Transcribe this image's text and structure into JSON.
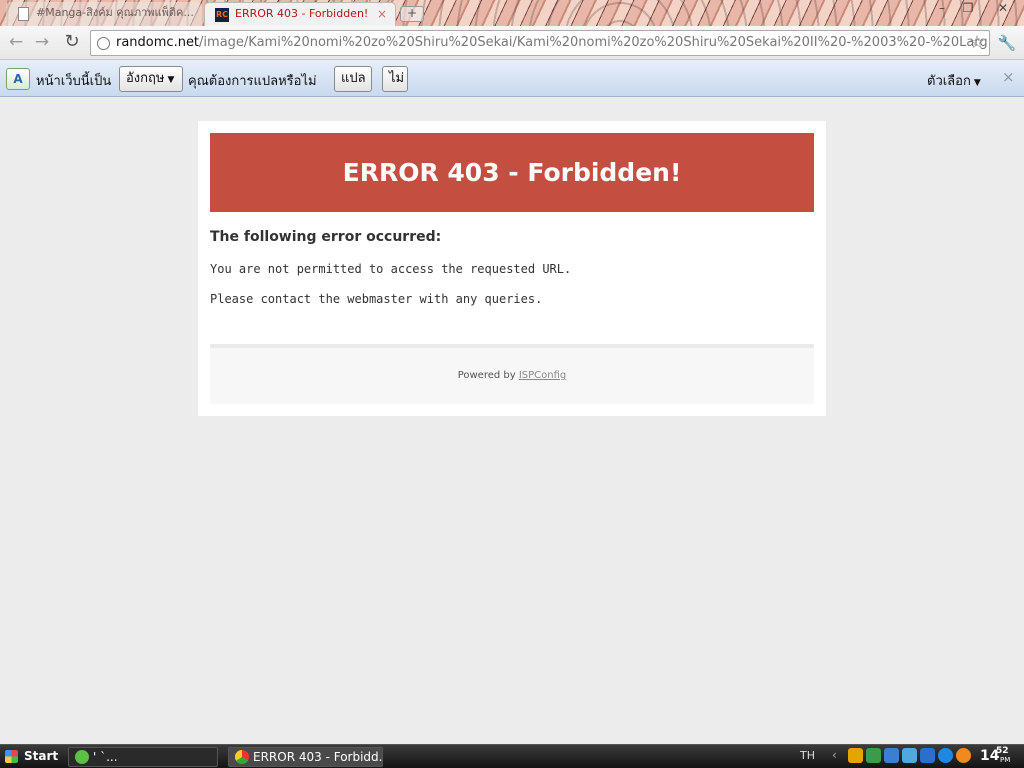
{
  "browser": {
    "tabs": [
      {
        "title": "#Manga-สิงค์ม คุณภาพแพ็ติค..."
      },
      {
        "title": "ERROR 403 - Forbidden!",
        "favicon_text": "RC"
      }
    ],
    "address_bar": {
      "host": "randomc.net",
      "path": "/image/Kami%20nomi%20zo%20Shiru%20Sekai/Kami%20nomi%20zo%20Shiru%20Sekai%20II%20-%2003%20-%20Larg"
    }
  },
  "translate_bar": {
    "lead_text": "หน้าเว็บนี้เป็น",
    "language": "อังกฤษ",
    "question": "คุณต้องการแปลหรือไม่",
    "translate_button": "แปล",
    "no_button": "ไม่",
    "options": "ตัวเลือก",
    "close": "×"
  },
  "page": {
    "banner_title": "ERROR 403 - Forbidden!",
    "heading": "The following error occurred:",
    "message": "You are not permitted to access the requested URL.",
    "contact": "Please contact the webmaster with any queries.",
    "footer_prefix": "Powered by",
    "footer_link": "ISPConfig"
  },
  "taskbar": {
    "start": "Start",
    "tasks": [
      {
        "title": "' `..."
      },
      {
        "title": "ERROR 403 - Forbidd..."
      }
    ],
    "language": "TH",
    "clock_hour": "14",
    "clock_min": "52",
    "clock_ampm": "PM"
  },
  "colors": {
    "banner": "#c44f40",
    "active_tab_text": "#b01818",
    "translate_bar": "#c9d9ee"
  },
  "icons": [
    "back-icon",
    "forward-icon",
    "reload-icon",
    "globe-icon",
    "star-icon",
    "wrench-icon",
    "translate-icon",
    "windows-logo-icon",
    "chrome-icon"
  ]
}
